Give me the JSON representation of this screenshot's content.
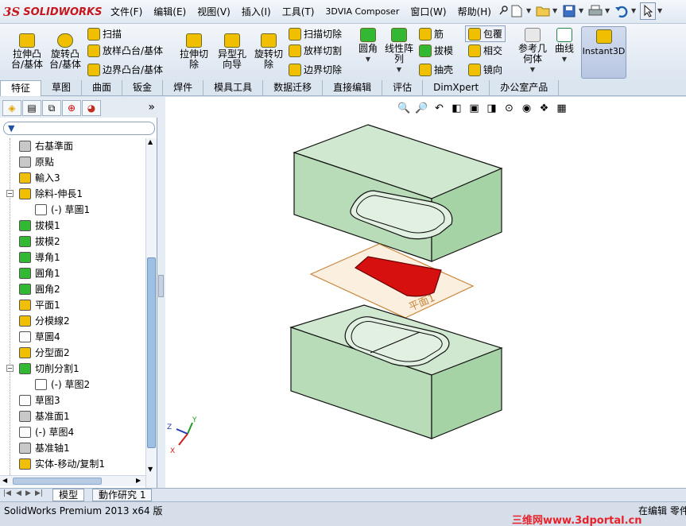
{
  "app": {
    "logo_mark": "3S",
    "logo_text": "SOLIDWORKS"
  },
  "menu": [
    "文件(F)",
    "编辑(E)",
    "视图(V)",
    "插入(I)",
    "工具(T)",
    "3DVIA Composer",
    "窗口(W)",
    "帮助(H)"
  ],
  "ribbon": {
    "extrude_boss": "拉伸凸台/基体",
    "revolve_boss": "旋转凸台/基体",
    "sweep": "扫描",
    "loft": "放样凸台/基体",
    "boundary": "边界凸台/基体",
    "extrude_cut": "拉伸切除",
    "hole_wizard": "异型孔向导",
    "revolve_cut": "旋转切除",
    "sweep_cut": "扫描切除",
    "loft_cut": "放样切割",
    "boundary_cut": "边界切除",
    "fillet": "圆角",
    "linear_pattern": "线性阵列",
    "rib": "筋",
    "draft": "拔模",
    "shell": "抽壳",
    "wrap": "包覆",
    "intersect": "相交",
    "mirror": "镜向",
    "ref_geometry": "参考几何体",
    "curves": "曲线",
    "instant3d": "Instant3D"
  },
  "tabs": [
    "特征",
    "草图",
    "曲面",
    "钣金",
    "焊件",
    "模具工具",
    "数据迁移",
    "直接编辑",
    "评估",
    "DimXpert",
    "办公室产品"
  ],
  "tree": [
    {
      "label": "右基準面",
      "icon": "plane-icon",
      "color": "#c8c8c8"
    },
    {
      "label": "原點",
      "icon": "origin-icon",
      "color": "#c8c8c8"
    },
    {
      "label": "輸入3",
      "icon": "import-body-icon",
      "color": "#f0c000"
    },
    {
      "label": "除料-伸長1",
      "icon": "cut-extrude-icon",
      "color": "#f0c000"
    },
    {
      "label": "(-) 草圖1",
      "icon": "sketch-icon",
      "color": "#ffffff"
    },
    {
      "label": "拔模1",
      "icon": "draft-icon",
      "color": "#33b833"
    },
    {
      "label": "拔模2",
      "icon": "draft-icon",
      "color": "#33b833"
    },
    {
      "label": "導角1",
      "icon": "chamfer-icon",
      "color": "#33b833"
    },
    {
      "label": "圓角1",
      "icon": "fillet-icon",
      "color": "#33b833"
    },
    {
      "label": "圓角2",
      "icon": "fillet-icon",
      "color": "#33b833"
    },
    {
      "label": "平面1",
      "icon": "plane-icon",
      "color": "#f0c000"
    },
    {
      "label": "分模線2",
      "icon": "parting-line-icon",
      "color": "#f0c000"
    },
    {
      "label": "草圖4",
      "icon": "sketch-icon",
      "color": "#ffffff"
    },
    {
      "label": "分型面2",
      "icon": "parting-surface-icon",
      "color": "#f0c000"
    },
    {
      "label": "切削分割1",
      "icon": "tooling-split-icon",
      "color": "#33b833"
    },
    {
      "label": "(-) 草图2",
      "icon": "sketch-icon",
      "color": "#ffffff"
    },
    {
      "label": "草图3",
      "icon": "sketch-icon",
      "color": "#ffffff"
    },
    {
      "label": "基准面1",
      "icon": "plane-icon",
      "color": "#c8c8c8"
    },
    {
      "label": "(-) 草图4",
      "icon": "sketch-icon",
      "color": "#ffffff"
    },
    {
      "label": "基准轴1",
      "icon": "axis-icon",
      "color": "#c8c8c8"
    },
    {
      "label": "实体-移动/复制1",
      "icon": "move-copy-icon",
      "color": "#f0c000"
    }
  ],
  "viewport": {
    "plane_label": "平面1",
    "axis_x": "X",
    "axis_y": "Y",
    "axis_z": "Z"
  },
  "bottom_tabs": [
    "模型",
    "動作研究 1"
  ],
  "status": {
    "left": "SolidWorks Premium 2013 x64 版",
    "right": "在编辑 零件"
  },
  "watermark": "三维网www.3dportal.cn"
}
